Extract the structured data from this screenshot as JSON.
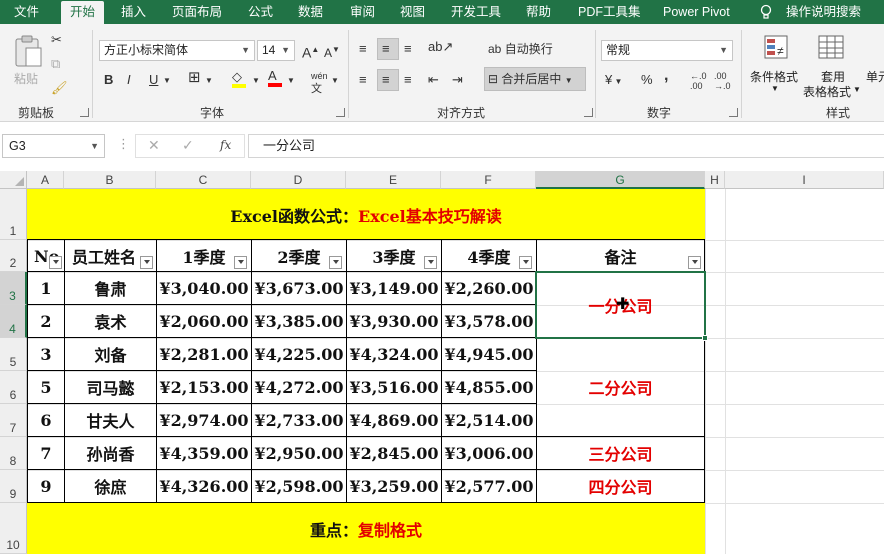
{
  "ribbon_tabs": [
    "文件",
    "开始",
    "插入",
    "页面布局",
    "公式",
    "数据",
    "审阅",
    "视图",
    "开发工具",
    "帮助",
    "PDF工具集",
    "Power Pivot",
    "操作说明搜索"
  ],
  "active_tab": "开始",
  "clipboard": {
    "paste_label": "粘贴",
    "group_label": "剪贴板"
  },
  "font_group": {
    "font_name": "方正小标宋简体",
    "font_size": "14",
    "bold": "B",
    "italic": "I",
    "underline": "U",
    "wen": "wén",
    "group_label": "字体"
  },
  "alignment_group": {
    "wrap_label": "自动换行",
    "merge_label": "合并后居中",
    "group_label": "对齐方式"
  },
  "number_group": {
    "format": "常规",
    "currency": "¥",
    "percent": "%",
    "comma": ",",
    "group_label": "数字"
  },
  "styles_group": {
    "conditional": "条件格式",
    "table_format_1": "套用",
    "table_format_2": "表格格式",
    "cell_styles": "单元",
    "group_label": "样式"
  },
  "formula_bar": {
    "name_box": "G3",
    "fx": "fx",
    "content": "一分公司"
  },
  "columns": [
    "A",
    "B",
    "C",
    "D",
    "E",
    "F",
    "G",
    "H",
    "I"
  ],
  "rows": [
    "1",
    "2",
    "3",
    "4",
    "5",
    "6",
    "7",
    "8",
    "9",
    "10"
  ],
  "selected_column": "G",
  "sheet": {
    "title_black": "Excel函数公式：",
    "title_red": "Excel基本技巧解读",
    "headers": [
      "No",
      "员工姓名",
      "1季度",
      "2季度",
      "3季度",
      "4季度",
      "备注"
    ],
    "records": [
      [
        "1",
        "鲁肃",
        "¥3,040.00",
        "¥3,673.00",
        "¥3,149.00",
        "¥2,260.00"
      ],
      [
        "2",
        "袁术",
        "¥2,060.00",
        "¥3,385.00",
        "¥3,930.00",
        "¥3,578.00"
      ],
      [
        "3",
        "刘备",
        "¥2,281.00",
        "¥4,225.00",
        "¥4,324.00",
        "¥4,945.00"
      ],
      [
        "5",
        "司马懿",
        "¥2,153.00",
        "¥4,272.00",
        "¥3,516.00",
        "¥4,855.00"
      ],
      [
        "6",
        "甘夫人",
        "¥2,974.00",
        "¥2,733.00",
        "¥4,869.00",
        "¥2,514.00"
      ],
      [
        "7",
        "孙尚香",
        "¥4,359.00",
        "¥2,950.00",
        "¥2,845.00",
        "¥3,006.00"
      ],
      [
        "9",
        "徐庶",
        "¥4,326.00",
        "¥2,598.00",
        "¥3,259.00",
        "¥2,577.00"
      ]
    ],
    "notes": [
      "一分公司",
      "二分公司",
      "三分公司",
      "四分公司"
    ],
    "footer_black": "重点：",
    "footer_red": "复制格式"
  },
  "colors": {
    "accent": "#217346",
    "highlight": "#ffff00",
    "note_red": "#e30000"
  }
}
